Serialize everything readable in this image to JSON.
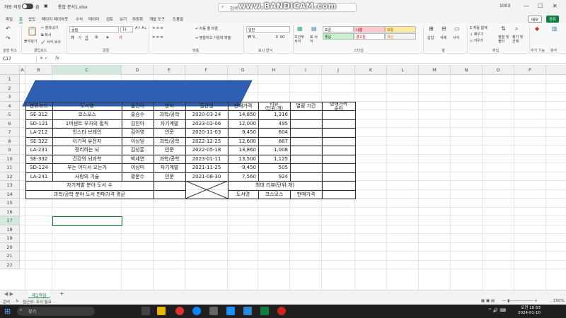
{
  "titlebar": {
    "autosave_label": "자동 저장",
    "autosave_state": "끔",
    "filename": "통합 문서1.xlsx",
    "search_placeholder": "검색",
    "watermark": "www.BANDICAM.com",
    "user": "1003"
  },
  "menu": {
    "tabs": [
      "파일",
      "홈",
      "삽입",
      "페이지 레이아웃",
      "수식",
      "데이터",
      "검토",
      "보기",
      "자동화",
      "개발 도구",
      "도움말"
    ],
    "active": "홈",
    "memo": "메모",
    "share": "공유"
  },
  "ribbon": {
    "undo_label": "실행 취소",
    "clipboard": {
      "paste": "붙여넣기",
      "cut": "잘라내기",
      "copy": "복사",
      "format_painter": "서식 복사",
      "label": "클립보드"
    },
    "font": {
      "name": "굴림",
      "size": "11",
      "label": "글꼴"
    },
    "alignment": {
      "wrap": "자동 줄 바꿈",
      "merge": "병합하고 가운데 맞춤",
      "label": "맞춤"
    },
    "number": {
      "format": "일반",
      "label": "표시 형식"
    },
    "styles": {
      "conditional": "조건부 서식",
      "table": "표 서식",
      "normal": "표준",
      "bad": "나쁨",
      "neutral": "보통",
      "good": "좋음",
      "warning": "경고문",
      "calculation": "계산",
      "label": "스타일"
    },
    "cells": {
      "insert": "삽입",
      "delete": "삭제",
      "format": "서식",
      "label": "셀"
    },
    "editing": {
      "autosum": "자동 합계",
      "fill": "채우기",
      "clear": "지우기",
      "sort": "정렬 및 필터",
      "find": "찾기 및 선택",
      "label": "편집"
    },
    "addins": {
      "label": "추가 기능"
    },
    "analysis": {
      "label": "분석"
    }
  },
  "formula": {
    "namebox": "C17",
    "fx": "fx",
    "content": ""
  },
  "columns": [
    "A",
    "B",
    "C",
    "D",
    "E",
    "F",
    "G",
    "H",
    "I",
    "J",
    "K",
    "L",
    "M",
    "N",
    "O",
    "P"
  ],
  "rows": [
    "1",
    "2",
    "3",
    "4",
    "5",
    "6",
    "7",
    "8",
    "9",
    "10",
    "11",
    "12",
    "13",
    "14",
    "15",
    "16",
    "17",
    "18",
    "19",
    "20",
    "21",
    "22"
  ],
  "table": {
    "headers": [
      "분류코드",
      "도서명",
      "옮긴이",
      "분야",
      "출간일",
      "판매가격",
      "리뷰\n(단위:개)",
      "열람 기간",
      "판매가격\n순위"
    ],
    "rows": [
      [
        "SE-312",
        "코스모스",
        "홍승수",
        "과학/공학",
        "2020-03-24",
        "14,850",
        "1,316",
        "",
        ""
      ],
      [
        "SD-121",
        "1퍼센트 부자의 법칙",
        "김진아",
        "자기계발",
        "2023-02-06",
        "12,000",
        "495",
        "",
        ""
      ],
      [
        "LA-212",
        "인스타 브레인",
        "김아영",
        "인문",
        "2020-11-03",
        "9,450",
        "604",
        "",
        ""
      ],
      [
        "SE-322",
        "이기적 유전자",
        "이상임",
        "과학/공학",
        "2022-12-25",
        "12,600",
        "867",
        "",
        ""
      ],
      [
        "LA-231",
        "정리하는 뇌",
        "김성훈",
        "인문",
        "2022-05-18",
        "13,860",
        "1,008",
        "",
        ""
      ],
      [
        "SE-332",
        "건강의 뇌과학",
        "박세연",
        "과학/공학",
        "2023-01-11",
        "13,500",
        "1,125",
        "",
        ""
      ],
      [
        "SD-124",
        "부는 어디서 오는가",
        "이상미",
        "자기계발",
        "2021-11-25",
        "9,450",
        "505",
        "",
        ""
      ],
      [
        "LA-241",
        "사랑의 기술",
        "황문수",
        "인문",
        "2021-08-30",
        "7,560",
        "924",
        "",
        ""
      ]
    ],
    "summary": {
      "self_dev_count": "자기계발 분야 도서 수",
      "sci_avg": "과학/공학 분야 도서 판매가격 평균",
      "max_review": "최대 리뷰(단위:개)",
      "book_title": "도서명",
      "cosmos": "코스모스",
      "price": "판매가격"
    }
  },
  "sheet": {
    "tab": "제1작업",
    "add": "+"
  },
  "status": {
    "ready": "준비",
    "accessibility": "접근성: 조사 필요",
    "zoom": "150%"
  },
  "taskbar": {
    "search": "찾기",
    "time": "오전 10:53",
    "date": "2024-01-10"
  },
  "colors": {
    "excel_green": "#107c41",
    "shape_blue": "#2e5fb0",
    "bad_bg": "#ffc7ce",
    "good_bg": "#c6efce",
    "neutral_bg": "#ffeb9c"
  }
}
